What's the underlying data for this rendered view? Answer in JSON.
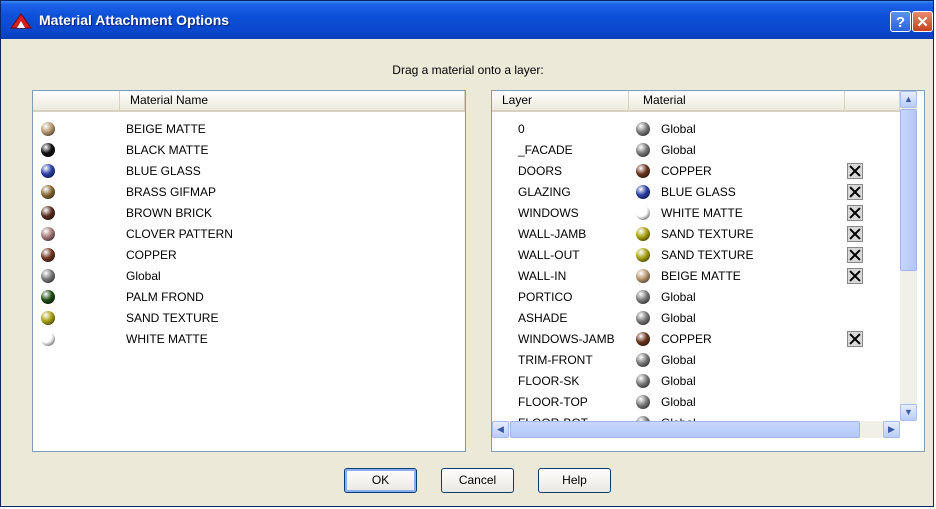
{
  "window": {
    "title": "Material Attachment Options",
    "help_glyph": "?",
    "close_glyph": "✕"
  },
  "instruction": "Drag a material onto a layer:",
  "materials_panel": {
    "header": "Material Name",
    "items": [
      {
        "name": "BEIGE MATTE",
        "color": "#b89670"
      },
      {
        "name": "BLACK MATTE",
        "color": "#111111"
      },
      {
        "name": "BLUE GLASS",
        "color": "#2a3fa8"
      },
      {
        "name": "BRASS GIFMAP",
        "color": "#8a6a35"
      },
      {
        "name": "BROWN BRICK",
        "color": "#5a2c1f"
      },
      {
        "name": "CLOVER PATTERN",
        "color": "#a47878"
      },
      {
        "name": "COPPER",
        "color": "#6e3520"
      },
      {
        "name": "Global",
        "color": "#7a7a7a"
      },
      {
        "name": "PALM FROND",
        "color": "#1e4d12"
      },
      {
        "name": "SAND TEXTURE",
        "color": "#a8a010"
      },
      {
        "name": "WHITE MATTE",
        "color": "#ffffff"
      }
    ]
  },
  "layers_panel": {
    "header_layer": "Layer",
    "header_material": "Material",
    "rows": [
      {
        "layer": "0",
        "material": "Global",
        "color": "#7a7a7a",
        "detach": false
      },
      {
        "layer": "_FACADE",
        "material": "Global",
        "color": "#7a7a7a",
        "detach": false
      },
      {
        "layer": "DOORS",
        "material": "COPPER",
        "color": "#6e3520",
        "detach": true
      },
      {
        "layer": "GLAZING",
        "material": "BLUE GLASS",
        "color": "#2a3fa8",
        "detach": true
      },
      {
        "layer": "WINDOWS",
        "material": "WHITE MATTE",
        "color": "#ffffff",
        "detach": true
      },
      {
        "layer": "WALL-JAMB",
        "material": "SAND TEXTURE",
        "color": "#a8a010",
        "detach": true
      },
      {
        "layer": "WALL-OUT",
        "material": "SAND TEXTURE",
        "color": "#a8a010",
        "detach": true
      },
      {
        "layer": "WALL-IN",
        "material": "BEIGE MATTE",
        "color": "#b89670",
        "detach": true
      },
      {
        "layer": "PORTICO",
        "material": "Global",
        "color": "#7a7a7a",
        "detach": false
      },
      {
        "layer": "ASHADE",
        "material": "Global",
        "color": "#7a7a7a",
        "detach": false
      },
      {
        "layer": "WINDOWS-JAMB",
        "material": "COPPER",
        "color": "#6e3520",
        "detach": true
      },
      {
        "layer": "TRIM-FRONT",
        "material": "Global",
        "color": "#7a7a7a",
        "detach": false
      },
      {
        "layer": "FLOOR-SK",
        "material": "Global",
        "color": "#7a7a7a",
        "detach": false
      },
      {
        "layer": "FLOOR-TOP",
        "material": "Global",
        "color": "#7a7a7a",
        "detach": false
      },
      {
        "layer": "FLOOR-BOT",
        "material": "Global",
        "color": "#7a7a7a",
        "detach": false
      }
    ]
  },
  "buttons": {
    "ok": "OK",
    "cancel": "Cancel",
    "help": "Help"
  }
}
